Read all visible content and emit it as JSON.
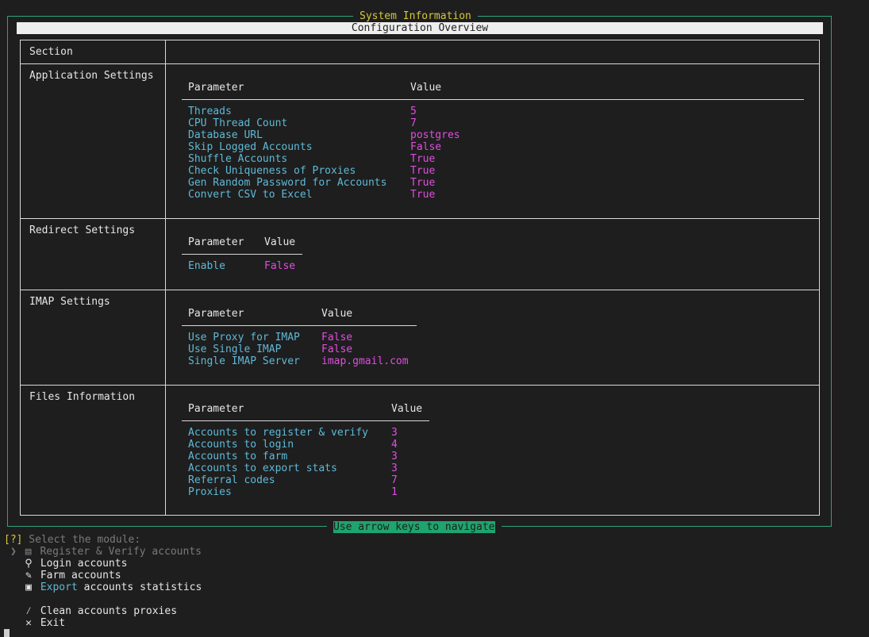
{
  "panel": {
    "title": "System Information",
    "subtitle": "Configuration Overview"
  },
  "table": {
    "header_section": "Section",
    "sections": [
      {
        "name": "Application Settings",
        "param_header": "Parameter",
        "value_header": "Value",
        "rows": [
          {
            "param": "Threads",
            "value": "5"
          },
          {
            "param": "CPU Thread Count",
            "value": "7"
          },
          {
            "param": "Database URL",
            "value": "postgres"
          },
          {
            "param": "Skip Logged Accounts",
            "value": "False"
          },
          {
            "param": "Shuffle Accounts",
            "value": "True"
          },
          {
            "param": "Check Uniqueness of Proxies",
            "value": "True"
          },
          {
            "param": "Gen Random Password for Accounts",
            "value": "True"
          },
          {
            "param": "Convert CSV to Excel",
            "value": "True"
          }
        ]
      },
      {
        "name": "Redirect Settings",
        "param_header": "Parameter",
        "value_header": "Value",
        "rows": [
          {
            "param": "Enable",
            "value": "False"
          }
        ]
      },
      {
        "name": "IMAP Settings",
        "param_header": "Parameter",
        "value_header": "Value",
        "rows": [
          {
            "param": "Use Proxy for IMAP",
            "value": "False"
          },
          {
            "param": "Use Single IMAP",
            "value": "False"
          },
          {
            "param": "Single IMAP Server",
            "value": "imap.gmail.com"
          }
        ]
      },
      {
        "name": "Files Information",
        "param_header": "Parameter",
        "value_header": "Value",
        "rows": [
          {
            "param": "Accounts to register & verify",
            "value": "3"
          },
          {
            "param": "Accounts to login",
            "value": "4"
          },
          {
            "param": "Accounts to farm",
            "value": "3"
          },
          {
            "param": "Accounts to export stats",
            "value": "3"
          },
          {
            "param": "Referral codes",
            "value": "7"
          },
          {
            "param": "Proxies",
            "value": "1"
          }
        ]
      }
    ]
  },
  "nav_hint": "Use arrow keys to navigate",
  "prompt": {
    "mark": "[?]",
    "text": " Select the module:"
  },
  "menu": {
    "pointer": "❯",
    "items": [
      {
        "icon": "▤",
        "icon_name": "register-icon",
        "label": "Register & Verify accounts"
      },
      {
        "icon": "⚲",
        "icon_name": "key-icon",
        "label": "Login accounts"
      },
      {
        "icon": "✎",
        "icon_name": "farm-icon",
        "label": "Farm accounts"
      },
      {
        "icon": "▣",
        "icon_name": "floppy-icon",
        "label_highlight": "Export",
        "label_rest": " accounts statistics"
      },
      {
        "icon": "⁄",
        "icon_name": "broom-icon",
        "label": "Clean accounts proxies"
      },
      {
        "icon": "✕",
        "icon_name": "close-icon",
        "label": "Exit"
      }
    ]
  },
  "colors": {
    "accent": "#2ea37a",
    "title": "#d7c83a",
    "param": "#5fb9d7",
    "value": "#e04de0"
  }
}
